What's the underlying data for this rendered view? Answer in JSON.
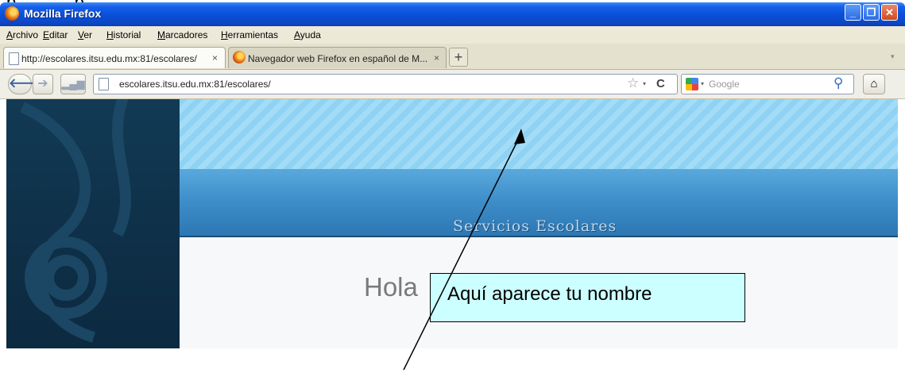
{
  "window": {
    "title": "Mozilla Firefox",
    "controls": {
      "minimize": "_",
      "maximize": "❐",
      "close": "✕"
    }
  },
  "menu": {
    "items": [
      {
        "key": "A",
        "rest": "rchivo"
      },
      {
        "key": "E",
        "rest": "ditar"
      },
      {
        "key": "V",
        "rest": "er"
      },
      {
        "key": "H",
        "rest": "istorial"
      },
      {
        "key": "M",
        "rest": "arcadores"
      },
      {
        "key": "H",
        "rest": "erramientas"
      },
      {
        "key": "A",
        "rest": "yuda"
      }
    ]
  },
  "tabs": [
    {
      "label": "http://escolares.itsu.edu.mx:81/escolares/",
      "close": "×",
      "active": true
    },
    {
      "label": "Navegador web Firefox en español de M...",
      "close": "×",
      "active": false
    }
  ],
  "new_tab_label": "+",
  "navbar": {
    "back": "🡐",
    "forward": "➔",
    "url": "escolares.itsu.edu.mx:81/escolares/",
    "search_placeholder": "Google",
    "home": "⌂",
    "reload": "C",
    "star": "☆",
    "dropdown": "▾",
    "magnifier": "⚲"
  },
  "page": {
    "header_title": "Servicios Escolares",
    "greeting": "Hola"
  },
  "annotation": {
    "callout": "Aquí aparece tu nombre"
  },
  "icons": {
    "firefox": "firefox-icon",
    "page": "page-icon",
    "google": "google-icon",
    "home": "home-icon"
  }
}
